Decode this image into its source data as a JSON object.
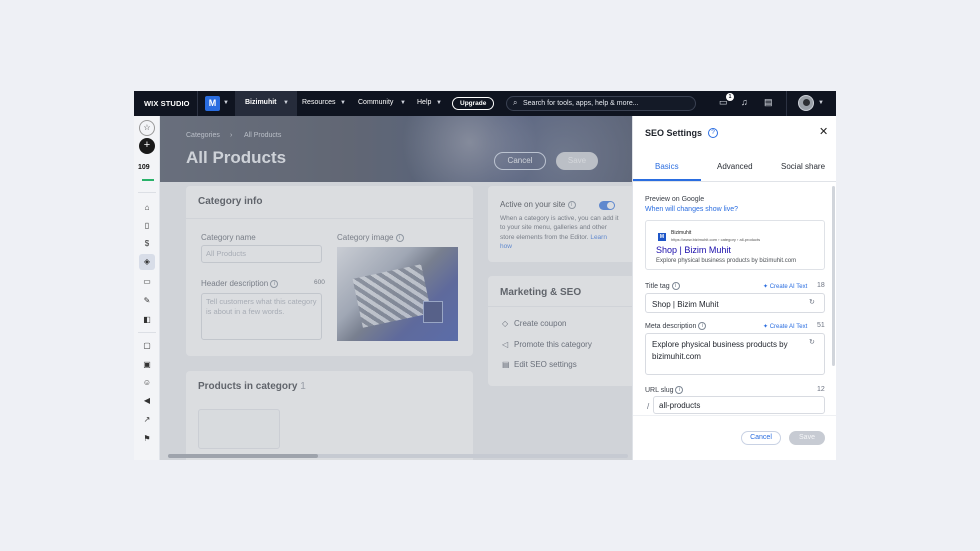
{
  "topbar": {
    "brand": "WIX STUDIO",
    "site_logo_letter": "M",
    "site_name": "Bizimuhit",
    "nav": [
      "Resources",
      "Community",
      "Help"
    ],
    "upgrade": "Upgrade",
    "search_placeholder": "Search for tools, apps, help & more...",
    "notification_count": "1"
  },
  "sidebar": {
    "counter": "109"
  },
  "main": {
    "breadcrumb": [
      "Categories",
      "All Products"
    ],
    "title": "All Products",
    "cancel": "Cancel",
    "save": "Save",
    "category_info": {
      "title": "Category info",
      "name_label": "Category name",
      "name_placeholder": "All Products",
      "image_label": "Category image",
      "header_desc_label": "Header description",
      "header_desc_count": "600",
      "header_desc_placeholder": "Tell customers what this category is about in a few words."
    },
    "active_card": {
      "title": "Active on your site",
      "text": "When a category is active, you can add it to your site menu, galleries and other store elements from the Editor.",
      "link": "Learn how"
    },
    "marketing": {
      "title": "Marketing & SEO",
      "items": [
        "Create coupon",
        "Promote this category",
        "Edit SEO settings"
      ]
    },
    "products": {
      "title": "Products in category",
      "count": "1"
    }
  },
  "seo_panel": {
    "title": "SEO Settings",
    "tabs": [
      "Basics",
      "Advanced",
      "Social share"
    ],
    "preview_label": "Preview on Google",
    "preview_link": "When will changes show live?",
    "preview": {
      "site": "Bizimuhit",
      "url": "https://www.bizimuhit.com › category › all-products",
      "title": "Shop | Bizim Muhit",
      "desc": "Explore physical business products by bizimuhit.com"
    },
    "title_tag": {
      "label": "Title tag",
      "ai": "Create AI Text",
      "count": "18",
      "value": "Shop | Bizim Muhit"
    },
    "meta": {
      "label": "Meta description",
      "ai": "Create AI Text",
      "count": "51",
      "value": "Explore physical business products by bizimuhit.com"
    },
    "slug": {
      "label": "URL slug",
      "count": "12",
      "prefix": "/",
      "value": "all-products"
    },
    "cancel": "Cancel",
    "save": "Save"
  },
  "colors": {
    "accent": "#2a6de0",
    "topbar": "#0f1420"
  },
  "icons": [
    "search-icon",
    "chat-icon",
    "bell-icon",
    "layout-icon",
    "star-icon",
    "plus-icon",
    "home-icon",
    "close-icon",
    "info-icon",
    "refresh-icon",
    "coupon-icon",
    "megaphone-icon",
    "edit-icon"
  ]
}
